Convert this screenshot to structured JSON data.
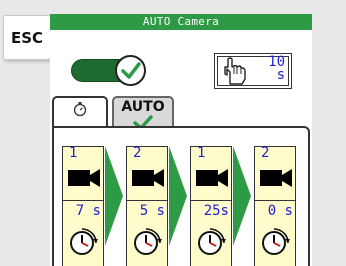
{
  "esc_label": "ESC",
  "title": "AUTO Camera",
  "toggle": {
    "state": "on",
    "icon": "check-icon"
  },
  "timer": {
    "value": "10",
    "unit": "s",
    "icon": "hand-pointer-icon"
  },
  "tabs": [
    {
      "icon": "stopwatch-icon",
      "label": ""
    },
    {
      "label": "AUTO",
      "icon": "check-icon"
    }
  ],
  "steps": [
    {
      "camera": "1",
      "duration": "7 s"
    },
    {
      "camera": "2",
      "duration": "5 s"
    },
    {
      "camera": "1",
      "duration": "25s"
    },
    {
      "camera": "2",
      "duration": "0 s"
    }
  ],
  "colors": {
    "title_bar": "#2f9a45",
    "toggle_track": "#1e6a30",
    "check_green": "#2f9a45",
    "cell_fill": "#fffccc",
    "value_blue": "#2020d0",
    "arrow_green": "#2f9a45"
  }
}
